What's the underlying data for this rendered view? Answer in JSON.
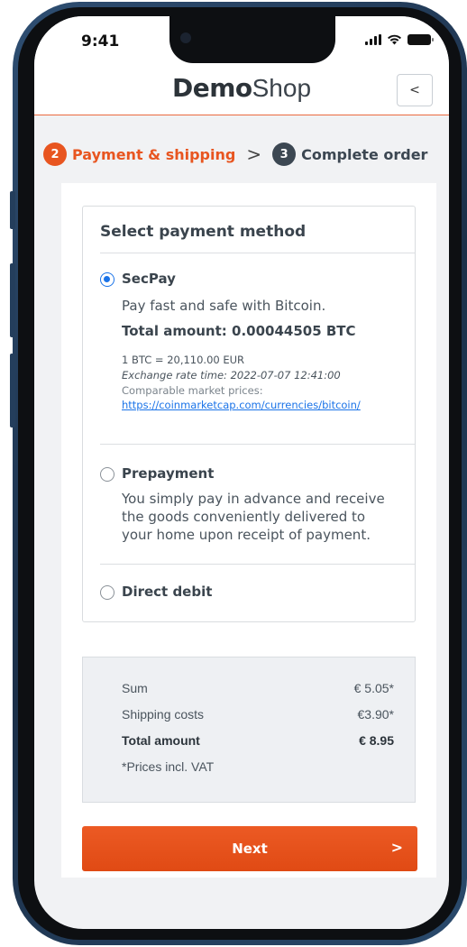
{
  "status_bar": {
    "time": "9:41"
  },
  "header": {
    "logo_bold": "Demo",
    "logo_light": "Shop",
    "back_label": "<"
  },
  "steps": [
    {
      "number": "2",
      "label": "Payment & shipping",
      "active": true
    },
    {
      "number": "3",
      "label": "Complete order",
      "active": false
    }
  ],
  "step_separator": ">",
  "payment": {
    "title": "Select payment method",
    "options": [
      {
        "label": "SecPay",
        "selected": true,
        "description": "Pay fast and safe with Bitcoin.",
        "total": "Total amount: 0.00044505 BTC",
        "rate": "1 BTC = 20,110.00 EUR",
        "rate_time": "Exchange rate time: 2022-07-07 12:41:00",
        "market_label": "Comparable market prices:",
        "market_link": "https://coinmarketcap.com/currencies/bitcoin/"
      },
      {
        "label": "Prepayment",
        "selected": false,
        "description_lines": [
          "You simply pay in advance and receive",
          "the goods conveniently delivered to",
          "your home upon receipt of payment."
        ]
      },
      {
        "label": "Direct debit",
        "selected": false
      }
    ]
  },
  "summary": {
    "rows": [
      {
        "label": "Sum",
        "value": "€ 5.05*"
      },
      {
        "label": "Shipping costs",
        "value": "€3.90*"
      },
      {
        "label": "Total amount",
        "value": "€ 8.95"
      }
    ],
    "note": "*Prices incl. VAT"
  },
  "next_button": {
    "label": "Next",
    "chevron": ">"
  },
  "colors": {
    "accent": "#e85520",
    "radio_selected": "#1a73e8",
    "step_inactive": "#3c4752",
    "link": "#1a73e8"
  }
}
